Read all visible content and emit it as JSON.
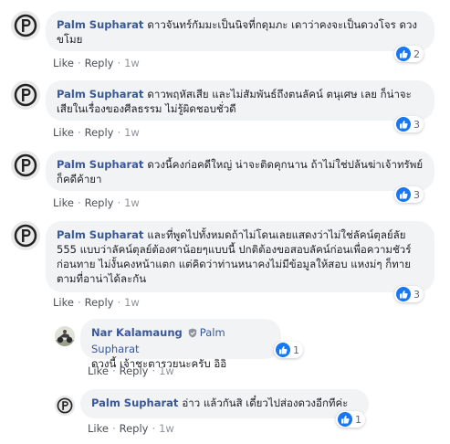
{
  "actions": {
    "like": "Like",
    "reply": "Reply",
    "sep": "·"
  },
  "colors": {
    "author": "#385898",
    "bubble": "#f2f3f5",
    "like_blue": "#1877f2"
  },
  "comments": [
    {
      "author": "Palm Supharat",
      "text": "ดาวจันทร์กัมมะเป็นนิจที่กดุมภะ เดาว่าคงจะเป็นดวงโจร ดวงขโมย",
      "time": "1w",
      "reactions": "2",
      "avatar_icon": "letter-p-logo"
    },
    {
      "author": "Palm Supharat",
      "text": "ดาวพฤหัสเสีย และไม่สัมพันธ์ถึงตนลัคน์ ตนุเศษ เลย ก็น่าจะเสียในเรื่องของศีลธรรม ไม่รู้ผิดชอบชั่วดี",
      "time": "1w",
      "reactions": "3",
      "avatar_icon": "letter-p-logo"
    },
    {
      "author": "Palm Supharat",
      "text": "ดวงนี้คงก่อคดีใหญ่ น่าจะติดคุกนาน ถ้าไม่ใช่ปล้นฆ่าเจ้าทรัพย์ ก็คดีค้ายา",
      "time": "1w",
      "reactions": "3",
      "avatar_icon": "letter-p-logo"
    },
    {
      "author": "Palm Supharat",
      "text": "และที่พูดไปทั้งหมดถ้าไม่โดนเลยแสดงว่าไม่ใช่ลัคน์ตุลย์ลัย 555 แบบว่าลัคน์ตุลย์ต้องศาน้อยๆแบบนี้ ปกติต้องขอสอบลัคน์ก่อนเพื่อความชัวร์ก่อนทาย ไม่งั้นคงหน้าแตก แต่คิดว่าท่านหนาคงไม่มีข้อมูลให้สอบ แหงม่ๆ ก็ทายตามที่อาน่าได้ละกัน",
      "time": "1w",
      "reactions": "3",
      "avatar_icon": "letter-p-logo"
    }
  ],
  "replies": [
    {
      "author": "Nar Kalamaung",
      "target": "Palm Supharat",
      "text": "ดวงนี้ เจ้าชะตารวยนะครับ อิอิ",
      "time": "1w",
      "reactions": "1",
      "avatar_icon": "motorbike-photo",
      "badge_icon": "shield-icon"
    },
    {
      "author": "Palm Supharat",
      "text": "อ่าว แล้วกันสิ เดี๋ยวไปส่องดวงอีกทีค่ะ",
      "time": "1w",
      "reactions": "1",
      "avatar_icon": "letter-p-logo"
    }
  ]
}
